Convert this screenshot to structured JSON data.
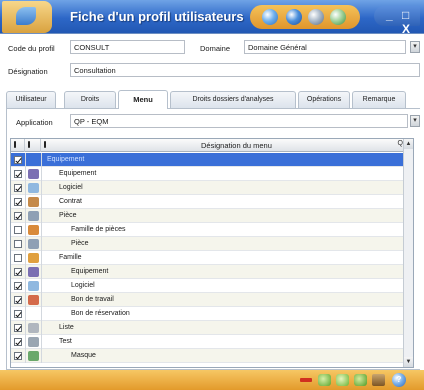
{
  "window": {
    "title": "Fiche d'un profil utilisateurs",
    "minimize_label": "_",
    "close_label": "□ X"
  },
  "form": {
    "code_label": "Code du profil",
    "code_value": "CONSULT",
    "domaine_label": "Domaine",
    "domaine_value": "Domaine Général",
    "designation_label": "Désignation",
    "designation_value": "Consultation"
  },
  "tabs": [
    {
      "label": "Utilisateur"
    },
    {
      "label": "Droits"
    },
    {
      "label": "Menu",
      "active": true
    },
    {
      "label": "Droits dossiers d'analyses"
    },
    {
      "label": "Opérations"
    },
    {
      "label": "Remarque"
    }
  ],
  "menu_tab": {
    "application_label": "Application",
    "application_value": "QP - EQM"
  },
  "grid": {
    "header_title": "Désignation du menu",
    "sort_glyph": "Q",
    "rows": [
      {
        "label": "Equipement",
        "checked": true,
        "selected": true,
        "icon": "none-icon",
        "icon_color": "",
        "indent": 0
      },
      {
        "label": "Equipement",
        "checked": true,
        "icon": "equipment-icon",
        "icon_color": "#7b6fb3",
        "indent": 1
      },
      {
        "label": "Logiciel",
        "checked": true,
        "icon": "software-icon",
        "icon_color": "#8fb8e0",
        "indent": 1
      },
      {
        "label": "Contrat",
        "checked": true,
        "icon": "contract-icon",
        "icon_color": "#c58a4a",
        "indent": 1
      },
      {
        "label": "Pièce",
        "checked": true,
        "icon": "part-icon",
        "icon_color": "#8fa0b4",
        "indent": 1
      },
      {
        "label": "Famille de pièces",
        "checked": false,
        "icon": "part-family-icon",
        "icon_color": "#d98a3a",
        "indent": 2
      },
      {
        "label": "Pièce",
        "checked": false,
        "icon": "part-icon",
        "icon_color": "#8fa0b4",
        "indent": 2
      },
      {
        "label": "Famille",
        "checked": false,
        "icon": "family-icon",
        "icon_color": "#e0a040",
        "indent": 1
      },
      {
        "label": "Equipement",
        "checked": true,
        "icon": "equipment-icon",
        "icon_color": "#7b6fb3",
        "indent": 2
      },
      {
        "label": "Logiciel",
        "checked": true,
        "icon": "software-icon",
        "icon_color": "#8fb8e0",
        "indent": 2
      },
      {
        "label": "Bon de travail",
        "checked": true,
        "icon": "work-order-icon",
        "icon_color": "#d46a4a",
        "indent": 2
      },
      {
        "label": "Bon de réservation",
        "checked": true,
        "icon": "none-icon",
        "icon_color": "",
        "indent": 2
      },
      {
        "label": "Liste",
        "checked": true,
        "icon": "list-icon",
        "icon_color": "#b0b6be",
        "indent": 1
      },
      {
        "label": "Test",
        "checked": true,
        "icon": "test-icon",
        "icon_color": "#9aa6b2",
        "indent": 1
      },
      {
        "label": "Masque",
        "checked": true,
        "icon": "mask-icon",
        "icon_color": "#6aa86a",
        "indent": 2
      }
    ]
  },
  "colors": {
    "titlebar": "#2d67c7",
    "accent_orange": "#e39a2b",
    "selection": "#3a6fd8",
    "row_alt": "#f5f5ec"
  },
  "bottombar": {
    "help_label": "?"
  }
}
